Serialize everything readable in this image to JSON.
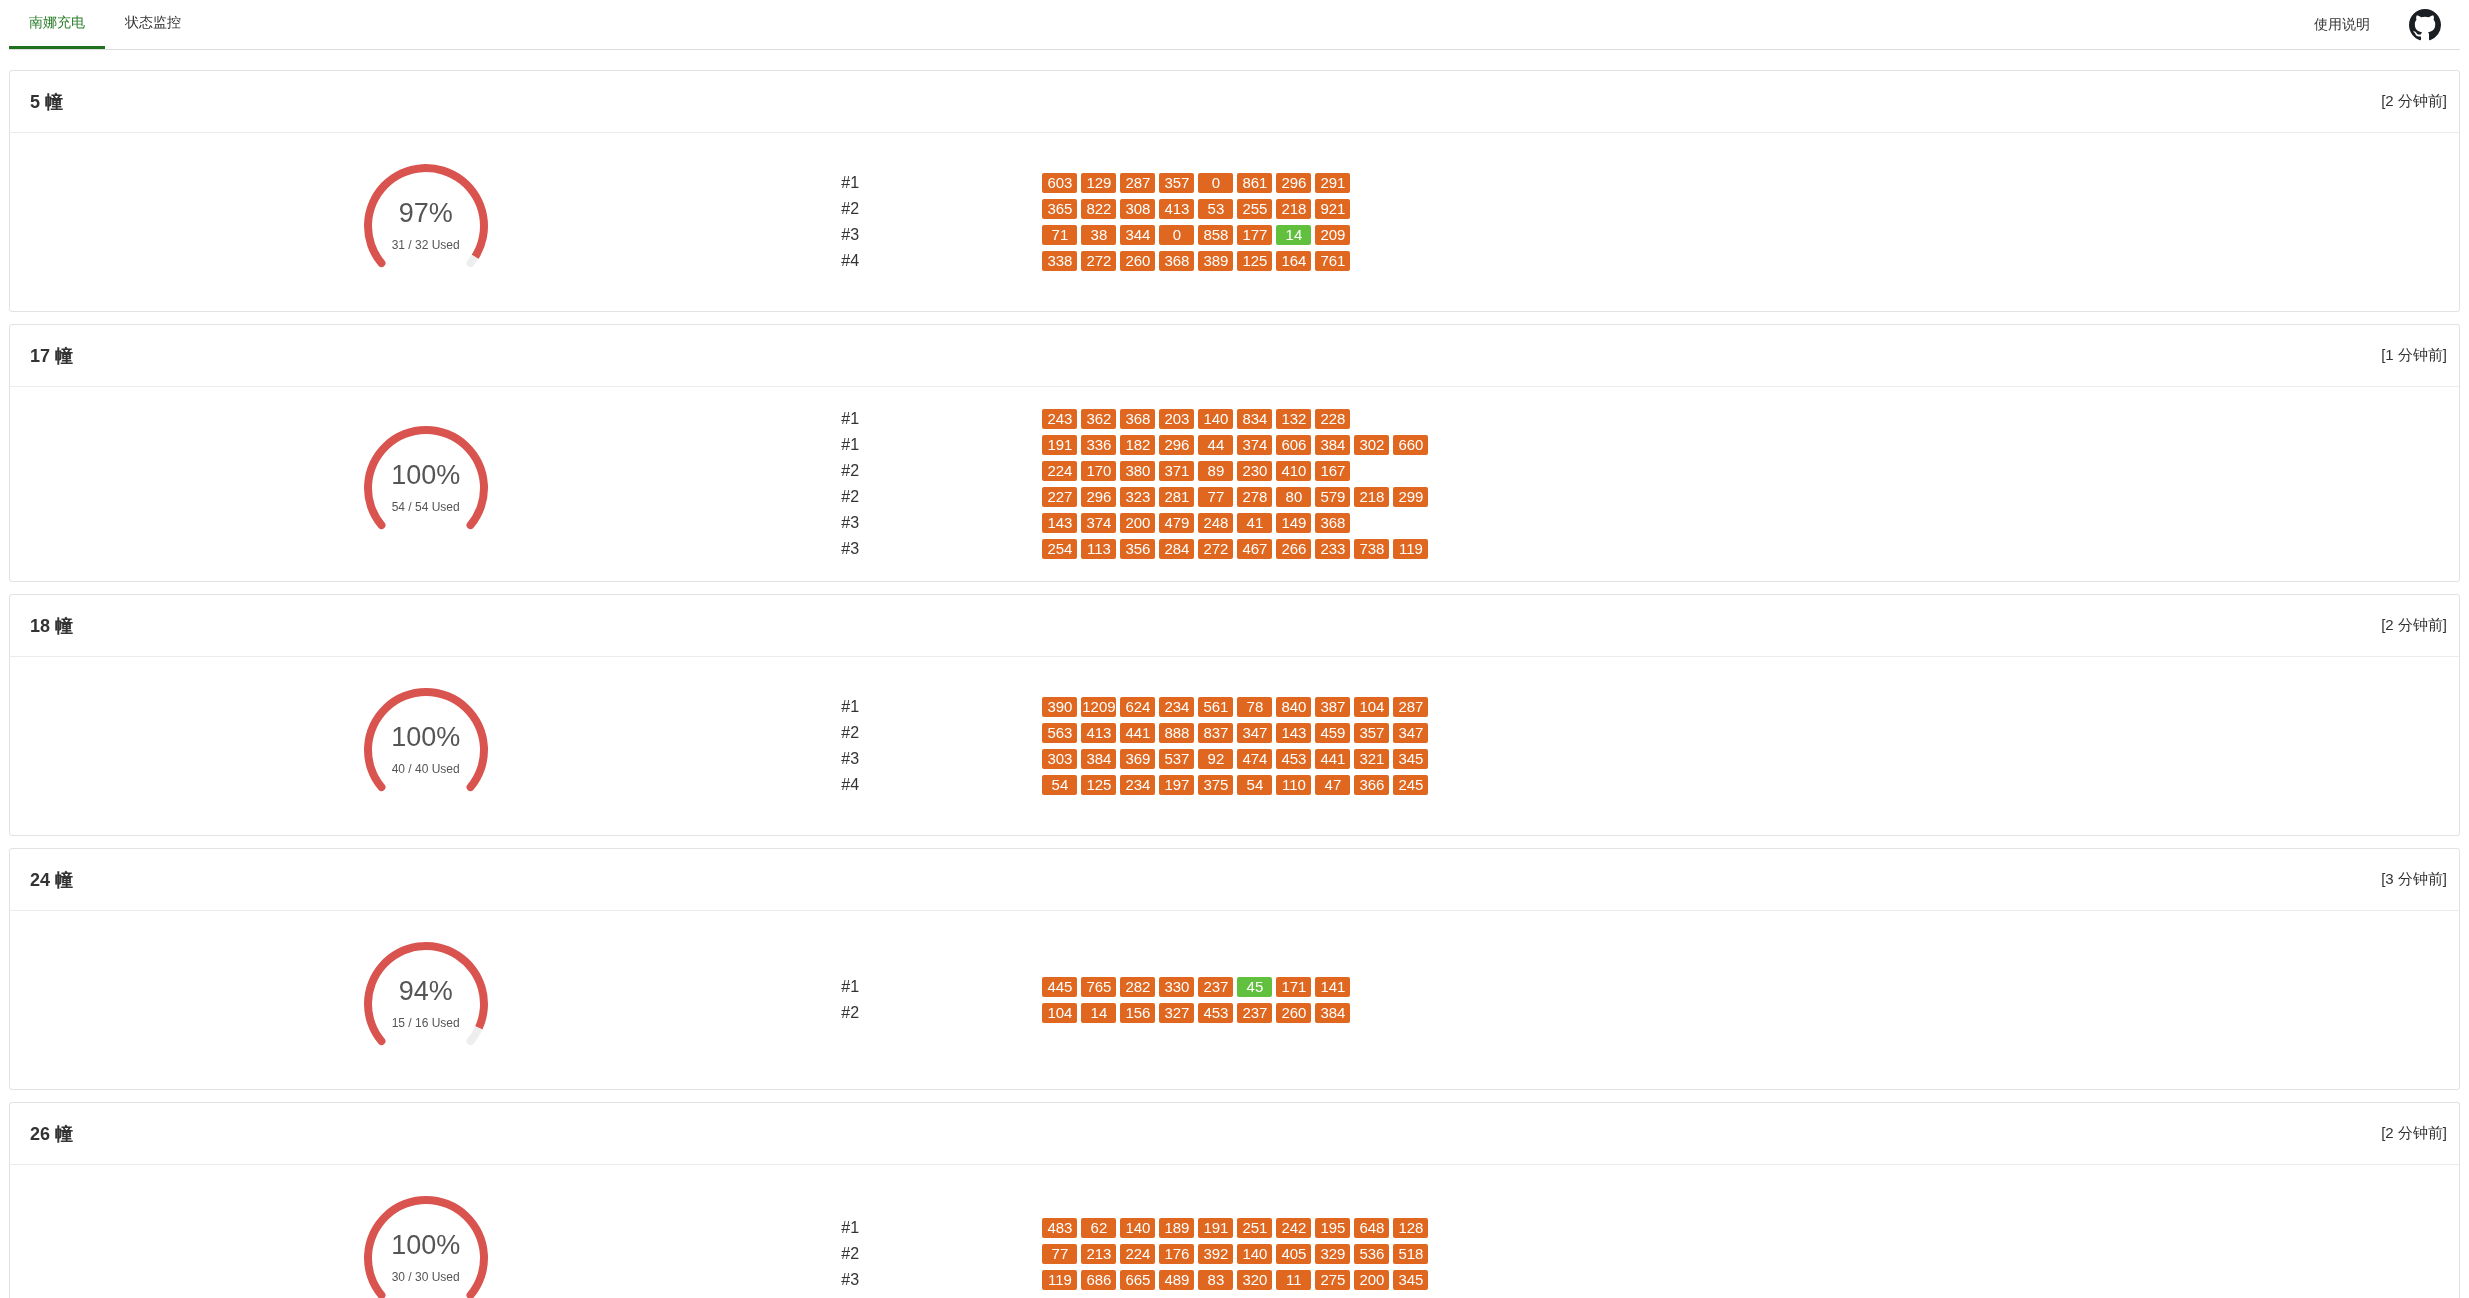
{
  "nav": {
    "tabs": [
      {
        "label": "南娜充电",
        "selected": true
      },
      {
        "label": "状态监控",
        "selected": false
      }
    ],
    "help_link": "使用说明"
  },
  "cards": [
    {
      "title": "5 幢",
      "updated": "[2 分钟前]",
      "gauge": {
        "percent": "97%",
        "used": "31 / 32 Used",
        "level": 0.97
      },
      "rows": [
        {
          "label": "#1",
          "tiles": [
            {
              "value": "603",
              "color": "#e0671f"
            },
            {
              "value": "129",
              "color": "#e0671f"
            },
            {
              "value": "287",
              "color": "#e0671f"
            },
            {
              "value": "357",
              "color": "#e0671f"
            },
            {
              "value": "0",
              "color": "#e0671f"
            },
            {
              "value": "861",
              "color": "#e0671f"
            },
            {
              "value": "296",
              "color": "#e0671f"
            },
            {
              "value": "291",
              "color": "#e0671f"
            }
          ]
        },
        {
          "label": "#2",
          "tiles": [
            {
              "value": "365",
              "color": "#e0671f"
            },
            {
              "value": "822",
              "color": "#e0671f"
            },
            {
              "value": "308",
              "color": "#e0671f"
            },
            {
              "value": "413",
              "color": "#e0671f"
            },
            {
              "value": "53",
              "color": "#e0671f"
            },
            {
              "value": "255",
              "color": "#e0671f"
            },
            {
              "value": "218",
              "color": "#e0671f"
            },
            {
              "value": "921",
              "color": "#e0671f"
            }
          ]
        },
        {
          "label": "#3",
          "tiles": [
            {
              "value": "71",
              "color": "#e0671f"
            },
            {
              "value": "38",
              "color": "#e0671f"
            },
            {
              "value": "344",
              "color": "#e0671f"
            },
            {
              "value": "0",
              "color": "#e0671f"
            },
            {
              "value": "858",
              "color": "#e0671f"
            },
            {
              "value": "177",
              "color": "#e0671f"
            },
            {
              "value": "14",
              "color": "#62c03f"
            },
            {
              "value": "209",
              "color": "#e0671f"
            }
          ]
        },
        {
          "label": "#4",
          "tiles": [
            {
              "value": "338",
              "color": "#e0671f"
            },
            {
              "value": "272",
              "color": "#e0671f"
            },
            {
              "value": "260",
              "color": "#e0671f"
            },
            {
              "value": "368",
              "color": "#e0671f"
            },
            {
              "value": "389",
              "color": "#e0671f"
            },
            {
              "value": "125",
              "color": "#e0671f"
            },
            {
              "value": "164",
              "color": "#e0671f"
            },
            {
              "value": "761",
              "color": "#e0671f"
            }
          ]
        }
      ]
    },
    {
      "title": "17 幢",
      "updated": "[1 分钟前]",
      "gauge": {
        "percent": "100%",
        "used": "54 / 54 Used",
        "level": 1
      },
      "rows": [
        {
          "label": "#1",
          "tiles": [
            {
              "value": "243",
              "color": "#e0671f"
            },
            {
              "value": "362",
              "color": "#e0671f"
            },
            {
              "value": "368",
              "color": "#e0671f"
            },
            {
              "value": "203",
              "color": "#e0671f"
            },
            {
              "value": "140",
              "color": "#e0671f"
            },
            {
              "value": "834",
              "color": "#e0671f"
            },
            {
              "value": "132",
              "color": "#e0671f"
            },
            {
              "value": "228",
              "color": "#e0671f"
            }
          ]
        },
        {
          "label": "#1",
          "tiles": [
            {
              "value": "191",
              "color": "#e0671f"
            },
            {
              "value": "336",
              "color": "#e0671f"
            },
            {
              "value": "182",
              "color": "#e0671f"
            },
            {
              "value": "296",
              "color": "#e0671f"
            },
            {
              "value": "44",
              "color": "#e0671f"
            },
            {
              "value": "374",
              "color": "#e0671f"
            },
            {
              "value": "606",
              "color": "#e0671f"
            },
            {
              "value": "384",
              "color": "#e0671f"
            },
            {
              "value": "302",
              "color": "#e0671f"
            },
            {
              "value": "660",
              "color": "#e0671f"
            }
          ]
        },
        {
          "label": "#2",
          "tiles": [
            {
              "value": "224",
              "color": "#e0671f"
            },
            {
              "value": "170",
              "color": "#e0671f"
            },
            {
              "value": "380",
              "color": "#e0671f"
            },
            {
              "value": "371",
              "color": "#e0671f"
            },
            {
              "value": "89",
              "color": "#e0671f"
            },
            {
              "value": "230",
              "color": "#e0671f"
            },
            {
              "value": "410",
              "color": "#e0671f"
            },
            {
              "value": "167",
              "color": "#e0671f"
            }
          ]
        },
        {
          "label": "#2",
          "tiles": [
            {
              "value": "227",
              "color": "#e0671f"
            },
            {
              "value": "296",
              "color": "#e0671f"
            },
            {
              "value": "323",
              "color": "#e0671f"
            },
            {
              "value": "281",
              "color": "#e0671f"
            },
            {
              "value": "77",
              "color": "#e0671f"
            },
            {
              "value": "278",
              "color": "#e0671f"
            },
            {
              "value": "80",
              "color": "#e0671f"
            },
            {
              "value": "579",
              "color": "#e0671f"
            },
            {
              "value": "218",
              "color": "#e0671f"
            },
            {
              "value": "299",
              "color": "#e0671f"
            }
          ]
        },
        {
          "label": "#3",
          "tiles": [
            {
              "value": "143",
              "color": "#e0671f"
            },
            {
              "value": "374",
              "color": "#e0671f"
            },
            {
              "value": "200",
              "color": "#e0671f"
            },
            {
              "value": "479",
              "color": "#e0671f"
            },
            {
              "value": "248",
              "color": "#e0671f"
            },
            {
              "value": "41",
              "color": "#e0671f"
            },
            {
              "value": "149",
              "color": "#e0671f"
            },
            {
              "value": "368",
              "color": "#e0671f"
            }
          ]
        },
        {
          "label": "#3",
          "tiles": [
            {
              "value": "254",
              "color": "#e0671f"
            },
            {
              "value": "113",
              "color": "#e0671f"
            },
            {
              "value": "356",
              "color": "#e0671f"
            },
            {
              "value": "284",
              "color": "#e0671f"
            },
            {
              "value": "272",
              "color": "#e0671f"
            },
            {
              "value": "467",
              "color": "#e0671f"
            },
            {
              "value": "266",
              "color": "#e0671f"
            },
            {
              "value": "233",
              "color": "#e0671f"
            },
            {
              "value": "738",
              "color": "#e0671f"
            },
            {
              "value": "119",
              "color": "#e0671f"
            }
          ]
        }
      ]
    },
    {
      "title": "18 幢",
      "updated": "[2 分钟前]",
      "gauge": {
        "percent": "100%",
        "used": "40 / 40 Used",
        "level": 1
      },
      "rows": [
        {
          "label": "#1",
          "tiles": [
            {
              "value": "390",
              "color": "#e0671f"
            },
            {
              "value": "1209",
              "color": "#e0671f"
            },
            {
              "value": "624",
              "color": "#e0671f"
            },
            {
              "value": "234",
              "color": "#e0671f"
            },
            {
              "value": "561",
              "color": "#e0671f"
            },
            {
              "value": "78",
              "color": "#e0671f"
            },
            {
              "value": "840",
              "color": "#e0671f"
            },
            {
              "value": "387",
              "color": "#e0671f"
            },
            {
              "value": "104",
              "color": "#e0671f"
            },
            {
              "value": "287",
              "color": "#e0671f"
            }
          ]
        },
        {
          "label": "#2",
          "tiles": [
            {
              "value": "563",
              "color": "#e0671f"
            },
            {
              "value": "413",
              "color": "#e0671f"
            },
            {
              "value": "441",
              "color": "#e0671f"
            },
            {
              "value": "888",
              "color": "#e0671f"
            },
            {
              "value": "837",
              "color": "#e0671f"
            },
            {
              "value": "347",
              "color": "#e0671f"
            },
            {
              "value": "143",
              "color": "#e0671f"
            },
            {
              "value": "459",
              "color": "#e0671f"
            },
            {
              "value": "357",
              "color": "#e0671f"
            },
            {
              "value": "347",
              "color": "#e0671f"
            }
          ]
        },
        {
          "label": "#3",
          "tiles": [
            {
              "value": "303",
              "color": "#e0671f"
            },
            {
              "value": "384",
              "color": "#e0671f"
            },
            {
              "value": "369",
              "color": "#e0671f"
            },
            {
              "value": "537",
              "color": "#e0671f"
            },
            {
              "value": "92",
              "color": "#e0671f"
            },
            {
              "value": "474",
              "color": "#e0671f"
            },
            {
              "value": "453",
              "color": "#e0671f"
            },
            {
              "value": "441",
              "color": "#e0671f"
            },
            {
              "value": "321",
              "color": "#e0671f"
            },
            {
              "value": "345",
              "color": "#e0671f"
            }
          ]
        },
        {
          "label": "#4",
          "tiles": [
            {
              "value": "54",
              "color": "#e0671f"
            },
            {
              "value": "125",
              "color": "#e0671f"
            },
            {
              "value": "234",
              "color": "#e0671f"
            },
            {
              "value": "197",
              "color": "#e0671f"
            },
            {
              "value": "375",
              "color": "#e0671f"
            },
            {
              "value": "54",
              "color": "#e0671f"
            },
            {
              "value": "110",
              "color": "#e0671f"
            },
            {
              "value": "47",
              "color": "#e0671f"
            },
            {
              "value": "366",
              "color": "#e0671f"
            },
            {
              "value": "245",
              "color": "#e0671f"
            }
          ]
        }
      ]
    },
    {
      "title": "24 幢",
      "updated": "[3 分钟前]",
      "gauge": {
        "percent": "94%",
        "used": "15 / 16 Used",
        "level": 0.94
      },
      "rows": [
        {
          "label": "#1",
          "tiles": [
            {
              "value": "445",
              "color": "#e0671f"
            },
            {
              "value": "765",
              "color": "#e0671f"
            },
            {
              "value": "282",
              "color": "#e0671f"
            },
            {
              "value": "330",
              "color": "#e0671f"
            },
            {
              "value": "237",
              "color": "#e0671f"
            },
            {
              "value": "45",
              "color": "#62c03f"
            },
            {
              "value": "171",
              "color": "#e0671f"
            },
            {
              "value": "141",
              "color": "#e0671f"
            }
          ]
        },
        {
          "label": "#2",
          "tiles": [
            {
              "value": "104",
              "color": "#e0671f"
            },
            {
              "value": "14",
              "color": "#e0671f"
            },
            {
              "value": "156",
              "color": "#e0671f"
            },
            {
              "value": "327",
              "color": "#e0671f"
            },
            {
              "value": "453",
              "color": "#e0671f"
            },
            {
              "value": "237",
              "color": "#e0671f"
            },
            {
              "value": "260",
              "color": "#e0671f"
            },
            {
              "value": "384",
              "color": "#e0671f"
            }
          ]
        }
      ]
    },
    {
      "title": "26 幢",
      "updated": "[2 分钟前]",
      "gauge": {
        "percent": "100%",
        "used": "30 / 30 Used",
        "level": 1
      },
      "rows": [
        {
          "label": "#1",
          "tiles": [
            {
              "value": "483",
              "color": "#e0671f"
            },
            {
              "value": "62",
              "color": "#e0671f"
            },
            {
              "value": "140",
              "color": "#e0671f"
            },
            {
              "value": "189",
              "color": "#e0671f"
            },
            {
              "value": "191",
              "color": "#e0671f"
            },
            {
              "value": "251",
              "color": "#e0671f"
            },
            {
              "value": "242",
              "color": "#e0671f"
            },
            {
              "value": "195",
              "color": "#e0671f"
            },
            {
              "value": "648",
              "color": "#e0671f"
            },
            {
              "value": "128",
              "color": "#e0671f"
            }
          ]
        },
        {
          "label": "#2",
          "tiles": [
            {
              "value": "77",
              "color": "#e0671f"
            },
            {
              "value": "213",
              "color": "#e0671f"
            },
            {
              "value": "224",
              "color": "#e0671f"
            },
            {
              "value": "176",
              "color": "#e0671f"
            },
            {
              "value": "392",
              "color": "#e0671f"
            },
            {
              "value": "140",
              "color": "#e0671f"
            },
            {
              "value": "405",
              "color": "#e0671f"
            },
            {
              "value": "329",
              "color": "#e0671f"
            },
            {
              "value": "536",
              "color": "#e0671f"
            },
            {
              "value": "518",
              "color": "#e0671f"
            }
          ]
        },
        {
          "label": "#3",
          "tiles": [
            {
              "value": "119",
              "color": "#e0671f"
            },
            {
              "value": "686",
              "color": "#e0671f"
            },
            {
              "value": "665",
              "color": "#e0671f"
            },
            {
              "value": "489",
              "color": "#e0671f"
            },
            {
              "value": "83",
              "color": "#e0671f"
            },
            {
              "value": "320",
              "color": "#e0671f"
            },
            {
              "value": "11",
              "color": "#e0671f"
            },
            {
              "value": "275",
              "color": "#e0671f"
            },
            {
              "value": "200",
              "color": "#e0671f"
            },
            {
              "value": "345",
              "color": "#e0671f"
            }
          ]
        }
      ]
    }
  ]
}
